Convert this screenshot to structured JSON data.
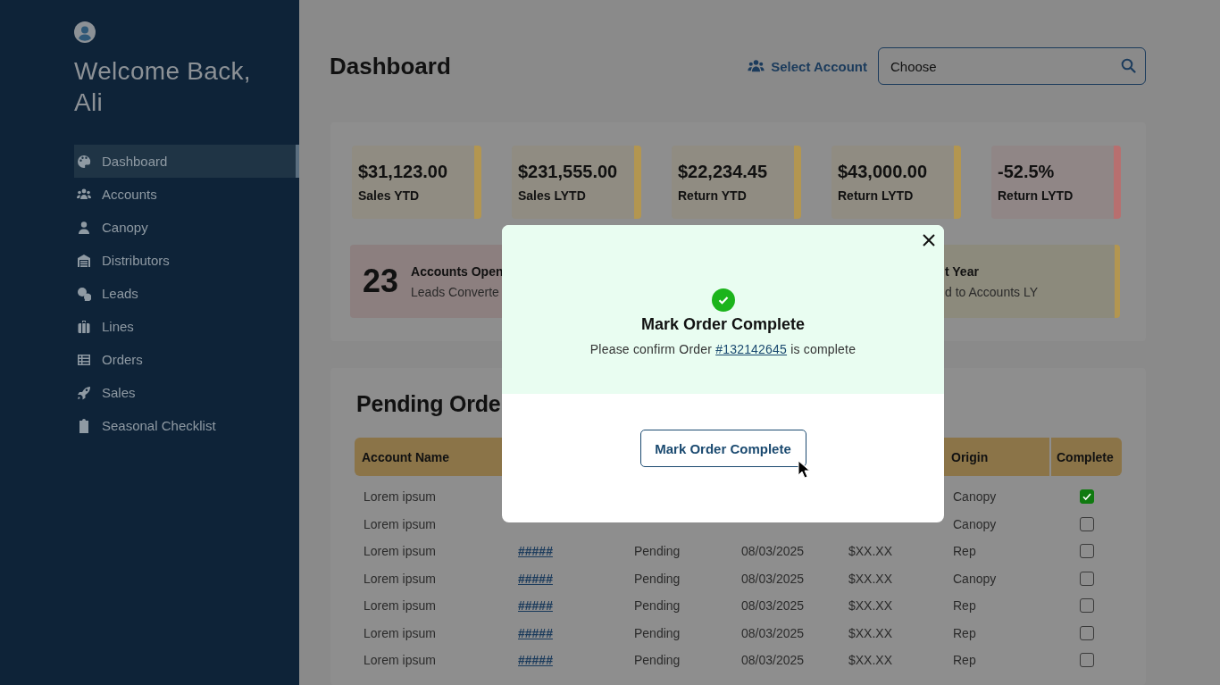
{
  "sidebar": {
    "greeting": "Welcome Back, Ali",
    "items": [
      {
        "label": "Dashboard",
        "selected": true
      },
      {
        "label": "Accounts",
        "selected": false
      },
      {
        "label": "Canopy",
        "selected": false
      },
      {
        "label": "Distributors",
        "selected": false
      },
      {
        "label": "Leads",
        "selected": false
      },
      {
        "label": "Lines",
        "selected": false
      },
      {
        "label": "Orders",
        "selected": false
      },
      {
        "label": "Sales",
        "selected": false
      },
      {
        "label": "Seasonal Checklist",
        "selected": false
      }
    ]
  },
  "header": {
    "title": "Dashboard",
    "select_label": "Select Account",
    "search": {
      "placeholder": "Choose"
    }
  },
  "kpis": [
    {
      "value": "$31,123.00",
      "label": "Sales YTD",
      "color": "#b39650"
    },
    {
      "value": "$231,555.00",
      "label": "Sales LYTD",
      "color": "#b39650"
    },
    {
      "value": "$22,234.45",
      "label": "Return YTD",
      "color": "#b39650"
    },
    {
      "value": "$43,000.00",
      "label": "Return LYTD",
      "color": "#b39650"
    },
    {
      "value": "-52.5%",
      "label": "Return LYTD",
      "color": "#b86f6f"
    }
  ],
  "summary_cards": [
    {
      "value": "23",
      "title": "Accounts Open",
      "subtitle": "Leads Converte",
      "kind": "negative"
    },
    {
      "title": "t Year",
      "subtitle": "d to Accounts LY",
      "kind": "neutral"
    }
  ],
  "pending_orders": {
    "title": "Pending Orde",
    "columns": [
      "Account Name",
      "Origin",
      "Complete"
    ],
    "rows": [
      {
        "account": "Lorem ipsum",
        "origin": "Canopy",
        "complete": true
      },
      {
        "account": "Lorem ipsum",
        "origin": "Canopy",
        "complete": false
      },
      {
        "account": "Lorem ipsum",
        "order": "#####",
        "status": "Pending",
        "date": "08/03/2025",
        "amount": "$XX.XX",
        "origin": "Rep",
        "complete": false
      },
      {
        "account": "Lorem ipsum",
        "order": "#####",
        "status": "Pending",
        "date": "08/03/2025",
        "amount": "$XX.XX",
        "origin": "Canopy",
        "complete": false
      },
      {
        "account": "Lorem ipsum",
        "order": "#####",
        "status": "Pending",
        "date": "08/03/2025",
        "amount": "$XX.XX",
        "origin": "Rep",
        "complete": false
      },
      {
        "account": "Lorem ipsum",
        "order": "#####",
        "status": "Pending",
        "date": "08/03/2025",
        "amount": "$XX.XX",
        "origin": "Rep",
        "complete": false
      },
      {
        "account": "Lorem ipsum",
        "order": "#####",
        "status": "Pending",
        "date": "08/03/2025",
        "amount": "$XX.XX",
        "origin": "Rep",
        "complete": false
      }
    ]
  },
  "modal": {
    "title": "Mark Order Complete",
    "message_before": "Please confirm Order",
    "order_link": "#132142645",
    "message_after": "is complete",
    "button": "Mark Order Complete"
  }
}
